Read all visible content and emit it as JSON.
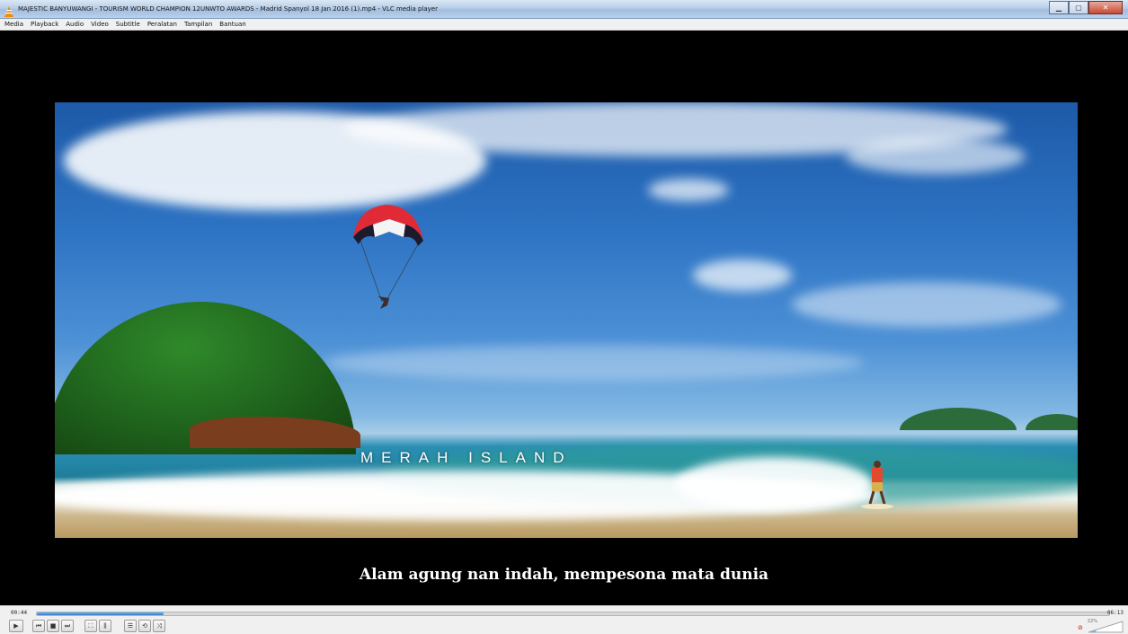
{
  "window": {
    "title": "MAJESTIC BANYUWANGI - TOURISM WORLD CHAMPION 12UNWTO AWARDS - Madrid Spanyol 18 Jan 2016 (1).mp4 - VLC media player",
    "minimize_label": "▁",
    "maximize_label": "▢",
    "close_label": "✕"
  },
  "menubar": {
    "items": [
      "Media",
      "Playback",
      "Audio",
      "Video",
      "Subtitle",
      "Peralatan",
      "Tampilan",
      "Bantuan"
    ]
  },
  "video": {
    "caption": "MERAH ISLAND",
    "subtitle": "Alam agung nan indah, mempesona mata dunia"
  },
  "playback": {
    "elapsed": "00:44",
    "duration": "06:13",
    "progress_fraction": 0.118,
    "volume_label": "22%",
    "volume_fraction": 0.22
  },
  "controls": {
    "play_icon": "play-icon",
    "prev_icon": "previous-icon",
    "stop_icon": "stop-icon",
    "next_icon": "next-icon",
    "fullscreen_icon": "fullscreen-icon",
    "extended_icon": "extended-settings-icon",
    "playlist_icon": "playlist-icon",
    "loop_icon": "loop-icon",
    "shuffle_icon": "shuffle-icon"
  },
  "colors": {
    "accent": "#2f7fcf",
    "brand_orange": "#f28c00"
  }
}
